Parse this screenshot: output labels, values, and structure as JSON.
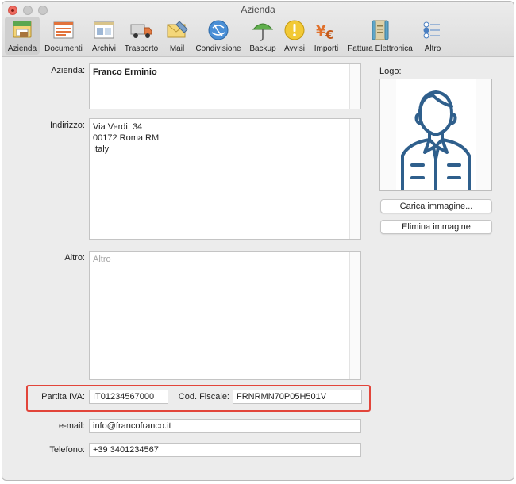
{
  "window": {
    "title": "Azienda"
  },
  "toolbar": {
    "items": [
      {
        "label": "Azienda",
        "icon": "company-icon"
      },
      {
        "label": "Documenti",
        "icon": "documents-icon"
      },
      {
        "label": "Archivi",
        "icon": "archives-icon"
      },
      {
        "label": "Trasporto",
        "icon": "truck-icon"
      },
      {
        "label": "Mail",
        "icon": "mail-icon"
      },
      {
        "label": "Condivisione",
        "icon": "network-icon"
      },
      {
        "label": "Backup",
        "icon": "umbrella-icon"
      },
      {
        "label": "Avvisi",
        "icon": "warning-icon"
      },
      {
        "label": "Importi",
        "icon": "currency-icon"
      },
      {
        "label": "Fattura Elettronica",
        "icon": "scroll-icon"
      },
      {
        "label": "Altro",
        "icon": "switches-icon"
      }
    ],
    "selected": "Azienda"
  },
  "form": {
    "azienda_label": "Azienda:",
    "azienda_value": "Franco Erminio",
    "indirizzo_label": "Indirizzo:",
    "indirizzo_lines": [
      "Via Verdi, 34",
      "00172 Roma RM",
      "Italy"
    ],
    "altro_label": "Altro:",
    "altro_placeholder": "Altro",
    "partita_iva_label": "Partita IVA:",
    "partita_iva_value": "IT01234567000",
    "cod_fiscale_label": "Cod. Fiscale:",
    "cod_fiscale_value": "FRNRMN70P05H501V",
    "email_label": "e-mail:",
    "email_value": "info@francofranco.it",
    "telefono_label": "Telefono:",
    "telefono_value": "+39 3401234567"
  },
  "logo": {
    "label": "Logo:",
    "load_button": "Carica immagine...",
    "delete_button": "Elimina immagine"
  },
  "colors": {
    "highlight": "#e2453a",
    "avatar": "#2f5f8c"
  }
}
